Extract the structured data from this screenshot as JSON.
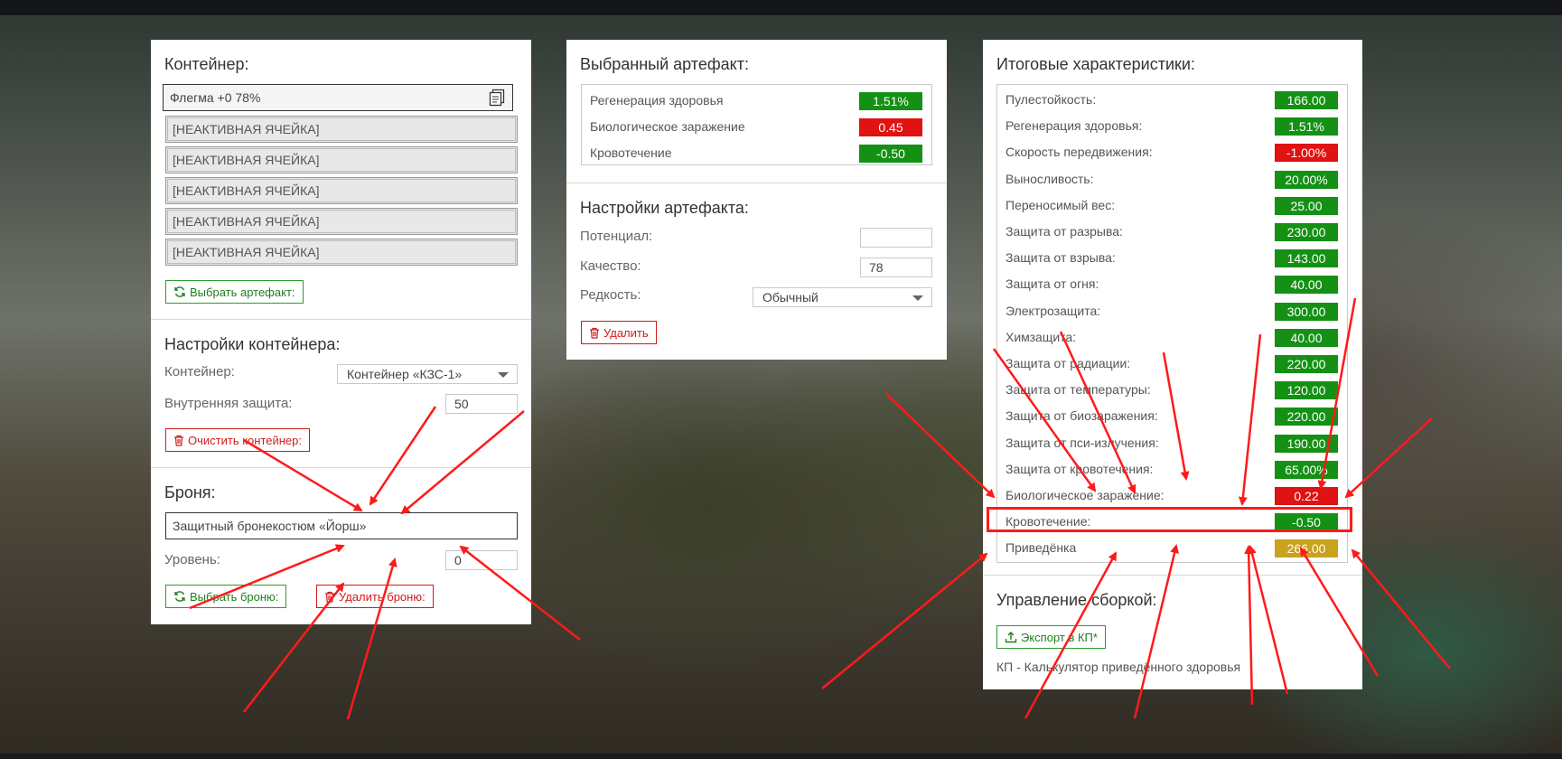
{
  "container_panel": {
    "title": "Контейнер:",
    "active_slot": "Флегма +0 78%",
    "inactive_slots": [
      "[НЕАКТИВНАЯ ЯЧЕЙКА]",
      "[НЕАКТИВНАЯ ЯЧЕЙКА]",
      "[НЕАКТИВНАЯ ЯЧЕЙКА]",
      "[НЕАКТИВНАЯ ЯЧЕЙКА]",
      "[НЕАКТИВНАЯ ЯЧЕЙКА]"
    ],
    "choose_artifact_button": "Выбрать артефакт:",
    "settings_title": "Настройки контейнера:",
    "container_label": "Контейнер:",
    "container_value": "Контейнер «КЗС-1»",
    "inner_protection_label": "Внутренняя защита:",
    "inner_protection_value": "50",
    "clear_button": "Очистить контейнер:",
    "armor_title": "Броня:",
    "armor_value": "Защитный бронекостюм «Йорш»",
    "level_label": "Уровень:",
    "level_value": "0",
    "choose_armor_button": "Выбрать броню:",
    "delete_armor_button": "Удалить броню:"
  },
  "artifact_panel": {
    "title": "Выбранный артефакт:",
    "stats": [
      {
        "name": "Регенерация здоровья",
        "value": "1.51%",
        "color": "#149114"
      },
      {
        "name": "Биологическое заражение",
        "value": "0.45",
        "color": "#e01212"
      },
      {
        "name": "Кровотечение",
        "value": "-0.50",
        "color": "#149114"
      }
    ],
    "settings_title": "Настройки артефакта:",
    "potential_label": "Потенциал:",
    "potential_value": "",
    "quality_label": "Качество:",
    "quality_value": "78",
    "rarity_label": "Редкость:",
    "rarity_value": "Обычный",
    "delete_button": "Удалить"
  },
  "totals_panel": {
    "title": "Итоговые характеристики:",
    "stats": [
      {
        "name": "Пулестойкость:",
        "value": "166.00",
        "color": "#149114"
      },
      {
        "name": "Регенерация здоровья:",
        "value": "1.51%",
        "color": "#149114"
      },
      {
        "name": "Скорость передвижения:",
        "value": "-1.00%",
        "color": "#e01212"
      },
      {
        "name": "Выносливость:",
        "value": "20.00%",
        "color": "#149114"
      },
      {
        "name": "Переносимый вес:",
        "value": "25.00",
        "color": "#149114"
      },
      {
        "name": "Защита от разрыва:",
        "value": "230.00",
        "color": "#149114"
      },
      {
        "name": "Защита от взрыва:",
        "value": "143.00",
        "color": "#149114"
      },
      {
        "name": "Защита от огня:",
        "value": "40.00",
        "color": "#149114"
      },
      {
        "name": "Электрозащита:",
        "value": "300.00",
        "color": "#149114"
      },
      {
        "name": "Химзащита:",
        "value": "40.00",
        "color": "#149114"
      },
      {
        "name": "Защита от радиации:",
        "value": "220.00",
        "color": "#149114"
      },
      {
        "name": "Защита от температуры:",
        "value": "120.00",
        "color": "#149114"
      },
      {
        "name": "Защита от биозаражения:",
        "value": "220.00",
        "color": "#149114"
      },
      {
        "name": "Защита от пси-излучения:",
        "value": "190.00",
        "color": "#149114"
      },
      {
        "name": "Защита от кровотечения:",
        "value": "65.00%",
        "color": "#149114"
      },
      {
        "name": "Биологическое заражение:",
        "value": "0.22",
        "color": "#e01212"
      },
      {
        "name": "Кровотечение:",
        "value": "-0.50",
        "color": "#149114"
      },
      {
        "name": "Приведёнка",
        "value": "266.00",
        "color": "#c9a21e"
      }
    ],
    "build_title": "Управление сборкой:",
    "export_button": "Экспорт в КП*",
    "footnote": "КП - Калькулятор приведённого здоровья"
  },
  "colors": {
    "accent_green": "#149114",
    "danger_red": "#e01212",
    "warning_yellow": "#c9a21e",
    "annotation_red": "#ff1a1a"
  }
}
